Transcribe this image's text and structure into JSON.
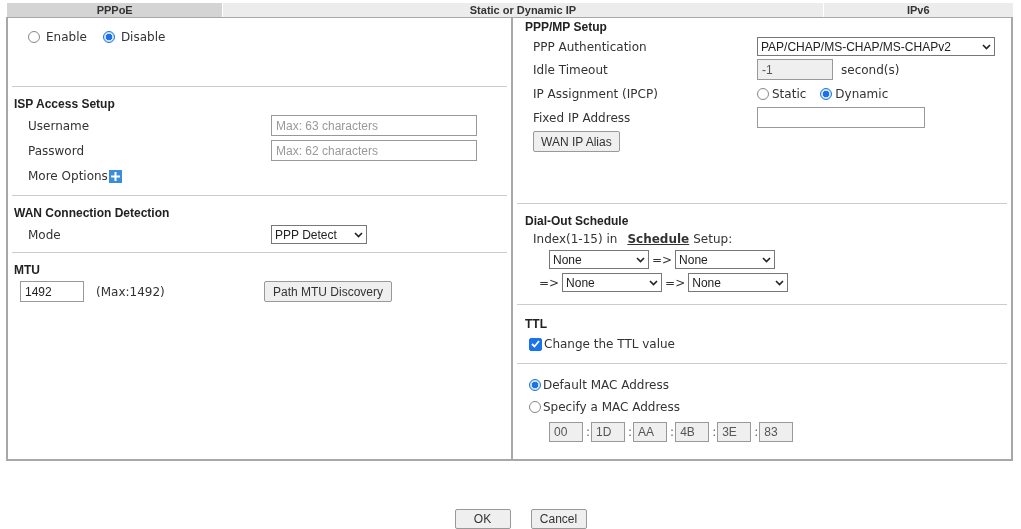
{
  "tabs": [
    {
      "label": "PPPoE",
      "selected": true
    },
    {
      "label": "Static or Dynamic IP",
      "selected": false
    },
    {
      "label": "IPv6",
      "selected": false
    }
  ],
  "left": {
    "status": [
      {
        "label": "Enable",
        "selected": false
      },
      {
        "label": "Disable",
        "selected": true
      }
    ],
    "isp_access": {
      "title": "ISP Access Setup",
      "fields": [
        {
          "label": "Username",
          "placeholder": "Max: 63 characters"
        },
        {
          "label": "Password",
          "placeholder": "Max: 62 characters"
        }
      ],
      "more_options": "More Options"
    },
    "wan_detection": {
      "title": "WAN Connection Detection",
      "mode_label": "Mode",
      "mode_value": "PPP Detect"
    },
    "mtu": {
      "title": "MTU",
      "value": "1492",
      "max_note": "(Max:1492)",
      "button": "Path MTU Discovery"
    }
  },
  "right": {
    "ppp": {
      "title": "PPP/MP Setup",
      "authentication": {
        "label": "PPP Authentication",
        "value": "PAP/CHAP/MS-CHAP/MS-CHAPv2"
      },
      "idle_timeout": {
        "label": "Idle Timeout",
        "value": "-1",
        "unit": "second(s)",
        "disabled": true
      },
      "ip_assignment": {
        "label": "IP Assignment (IPCP)",
        "options": [
          {
            "label": "Static",
            "selected": false
          },
          {
            "label": "Dynamic",
            "selected": true
          }
        ]
      },
      "fixed_ip": {
        "label": "Fixed IP Address"
      },
      "alias_button": "WAN IP Alias"
    },
    "dial_out": {
      "title": "Dial-Out Schedule",
      "index_text": "Index(1-15) in",
      "link": "Schedule",
      "suffix": "Setup:",
      "rows": [
        [
          {
            "kind": "select",
            "value": "None"
          },
          {
            "kind": "arrow",
            "text": "=>"
          },
          {
            "kind": "select",
            "value": "None"
          }
        ],
        [
          {
            "kind": "arrow",
            "text": "=>"
          },
          {
            "kind": "select",
            "value": "None"
          },
          {
            "kind": "arrow",
            "text": "=>"
          },
          {
            "kind": "select",
            "value": "None"
          }
        ]
      ]
    },
    "ttl": {
      "title": "TTL",
      "checkbox": {
        "label": "Change the TTL value",
        "checked": true
      }
    },
    "mac": {
      "options": [
        {
          "label": "Default MAC Address",
          "selected": true
        },
        {
          "label": "Specify a MAC Address",
          "selected": false
        }
      ],
      "disabled": true,
      "octets": [
        {
          "value": "00"
        },
        {
          "separator": ":",
          "value": "1D"
        },
        {
          "separator": ":",
          "value": "AA"
        },
        {
          "separator": ":",
          "value": "4B"
        },
        {
          "separator": ":",
          "value": "3E"
        },
        {
          "separator": ":",
          "value": "83"
        }
      ]
    }
  },
  "buttons": [
    "OK",
    "Cancel"
  ]
}
